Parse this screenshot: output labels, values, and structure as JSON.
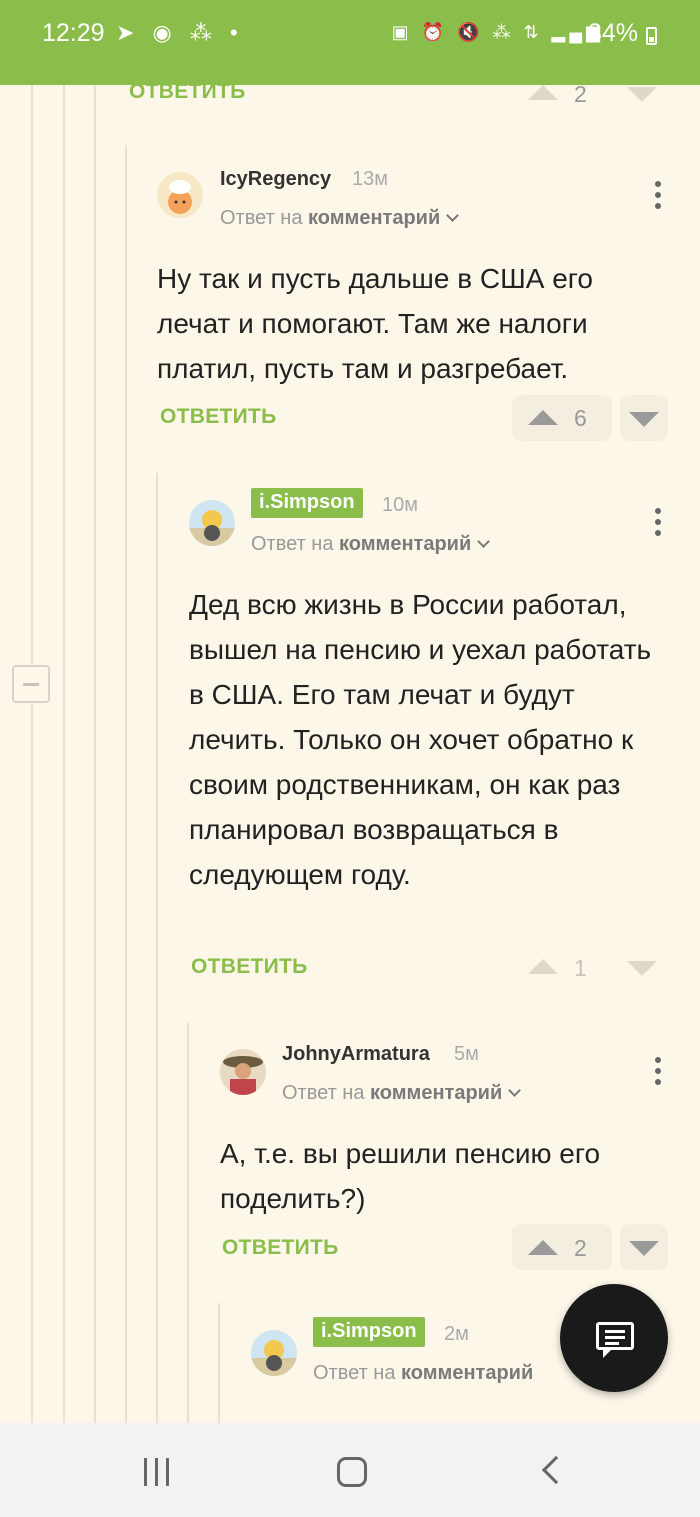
{
  "status_bar": {
    "time": "12:29",
    "left_icons": "➤ ◉ ⁂ •",
    "right_icons": "▣ ⏰ 🔇 ⁂ ⇅ ▂▄▆",
    "battery": "34%"
  },
  "thread": {
    "top_reply": {
      "reply_label": "ОТВЕТИТЬ",
      "votes": "2"
    },
    "comments": [
      {
        "author": "IcyRegency",
        "time": "13м",
        "reply_prefix": "Ответ на",
        "reply_target": "комментарий",
        "text": "Ну так и пусть дальше в США его лечат и помогают. Там же налоги платил, пусть там и разгребает.",
        "reply_label": "ОТВЕТИТЬ",
        "votes": "6"
      },
      {
        "author": "i.Simpson",
        "time": "10м",
        "reply_prefix": "Ответ на",
        "reply_target": "комментарий",
        "text": "Дед всю жизнь в России работал, вышел на пенсию и уехал работать в США. Его там лечат и будут лечить. Только он хочет обратно к своим родственникам, он как раз планировал возвращаться в следующем году.",
        "reply_label": "ОТВЕТИТЬ",
        "votes": "1"
      },
      {
        "author": "JohnyArmatura",
        "time": "5м",
        "reply_prefix": "Ответ на",
        "reply_target": "комментарий",
        "text": "А, т.е. вы решили пенсию его поделить?)",
        "reply_label": "ОТВЕТИТЬ",
        "votes": "2"
      },
      {
        "author": "i.Simpson",
        "time": "2м",
        "reply_prefix": "Ответ на",
        "reply_target": "комментарий"
      }
    ]
  },
  "colors": {
    "accent": "#8bbd4a",
    "background": "#fcf7e8",
    "fab": "#1a1a1a"
  },
  "icons": {
    "fab": "comment-icon",
    "nav": [
      "recent-apps-icon",
      "home-icon",
      "back-icon"
    ]
  }
}
